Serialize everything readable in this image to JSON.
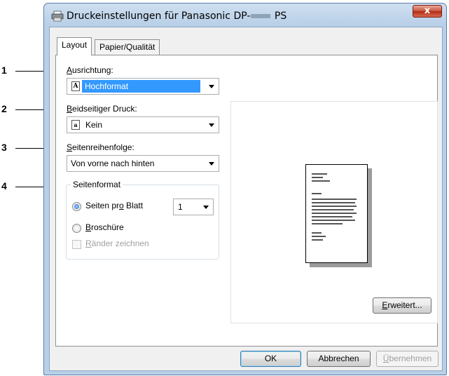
{
  "callouts": [
    "1",
    "2",
    "3",
    "4"
  ],
  "window": {
    "title_prefix": "Druckeinstellungen für Panasonic DP-",
    "title_suffix": " PS",
    "close_label": "x"
  },
  "tabs": [
    {
      "label": "Layout",
      "active": true
    },
    {
      "label": "Papier/Qualität",
      "active": false
    }
  ],
  "orientation": {
    "label_underlined": "A",
    "label_rest": "usrichtung:",
    "value": "Hochformat",
    "glyph": "A"
  },
  "duplex": {
    "label_underlined": "B",
    "label_rest": "eidseitiger Druck:",
    "value": "Kein",
    "glyph": "a"
  },
  "page_order": {
    "label_underlined": "S",
    "label_rest": "eitenreihenfolge:",
    "value": "Von vorne nach hinten"
  },
  "page_format": {
    "group_label": "Seitenformat",
    "pages_per_sheet_label_a": "Seiten pr",
    "pages_per_sheet_label_u": "o",
    "pages_per_sheet_label_b": " Blatt",
    "pages_per_sheet_value": "1",
    "pages_per_sheet_checked": true,
    "booklet_underlined": "B",
    "booklet_rest": "roschüre",
    "booklet_checked": false,
    "borders_underlined": "R",
    "borders_rest": "änder zeichnen",
    "borders_enabled": false
  },
  "buttons": {
    "advanced_underlined": "E",
    "advanced_rest": "rweitert...",
    "ok": "OK",
    "cancel": "Abbrechen",
    "apply_underlined": "Ü",
    "apply_rest": "bernehmen"
  },
  "colors": {
    "selection": "#3399ff",
    "close": "#c8523b",
    "frame": "#b9d0e8"
  },
  "icons": {
    "title": "printer-icon",
    "orientation": "portrait-page-icon",
    "duplex": "page-icon"
  }
}
